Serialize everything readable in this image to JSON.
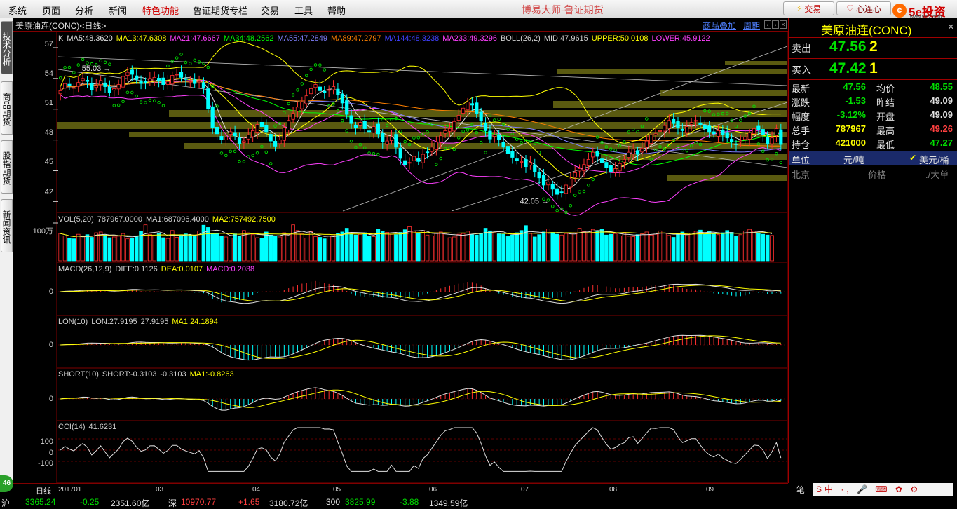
{
  "menu": [
    "系统",
    "页面",
    "分析",
    "新闻",
    "特色功能",
    "鲁证期货专栏",
    "交易",
    "工具",
    "帮助"
  ],
  "highlight_menu": "特色功能",
  "app_title": "博易大师-鲁证期货",
  "toolbar": {
    "trade_label": "交易",
    "xinlian_label": "心连心",
    "brand_text": "5e投资",
    "brand_url": "www.5etz.com"
  },
  "left_tabs": [
    "技术分析",
    "商品期货",
    "股指期货",
    "新闻资讯"
  ],
  "left_badge": "46",
  "chart_header": {
    "symbol": "美原油连(CONC)<日线>",
    "overlay_link": "商品叠加",
    "period_link": "周期"
  },
  "indicators": {
    "main": [
      {
        "text": "K",
        "color": "#d0d0d0"
      },
      {
        "text": "MA5:48.3620",
        "color": "#e0e0e0"
      },
      {
        "text": "MA13:47.6308",
        "color": "#ffff00"
      },
      {
        "text": "MA21:47.6667",
        "color": "#ff40ff"
      },
      {
        "text": "MA34:48.2562",
        "color": "#00ff00"
      },
      {
        "text": "MA55:47.2849",
        "color": "#8080ff"
      },
      {
        "text": "MA89:47.2797",
        "color": "#ff8000"
      },
      {
        "text": "MA144:48.3238",
        "color": "#4040ff"
      },
      {
        "text": "MA233:49.3296",
        "color": "#ff40ff"
      },
      {
        "text": "BOLL(26,2)",
        "color": "#d0d0d0"
      },
      {
        "text": "MID:47.9615",
        "color": "#d0d0d0"
      },
      {
        "text": "UPPER:50.0108",
        "color": "#ffff00"
      },
      {
        "text": "LOWER:45.9122",
        "color": "#ff40ff"
      }
    ],
    "vol": [
      {
        "text": "VOL(5,20)",
        "color": "#d0d0d0"
      },
      {
        "text": "787967.0000",
        "color": "#d0d0d0"
      },
      {
        "text": "MA1:687096.4000",
        "color": "#d0d0d0"
      },
      {
        "text": "MA2:757492.7500",
        "color": "#ffff00"
      }
    ],
    "macd": [
      {
        "text": "MACD(26,12,9)",
        "color": "#d0d0d0"
      },
      {
        "text": "DIFF:0.1126",
        "color": "#d0d0d0"
      },
      {
        "text": "DEA:0.0107",
        "color": "#ffff00"
      },
      {
        "text": "MACD:0.2038",
        "color": "#ff40ff"
      }
    ],
    "lon": [
      {
        "text": "LON(10)",
        "color": "#d0d0d0"
      },
      {
        "text": "LON:27.9195",
        "color": "#d0d0d0"
      },
      {
        "text": "27.9195",
        "color": "#d0d0d0"
      },
      {
        "text": "MA1:24.1894",
        "color": "#ffff00"
      }
    ],
    "short": [
      {
        "text": "SHORT(10)",
        "color": "#d0d0d0"
      },
      {
        "text": "SHORT:-0.3103",
        "color": "#d0d0d0"
      },
      {
        "text": "-0.3103",
        "color": "#d0d0d0"
      },
      {
        "text": "MA1:-0.8263",
        "color": "#ffff00"
      }
    ],
    "cci": [
      {
        "text": "CCI(14)",
        "color": "#d0d0d0"
      },
      {
        "text": "41.6231",
        "color": "#d0d0d0"
      }
    ]
  },
  "axes": {
    "price_ticks": [
      "57",
      "54",
      "51",
      "48",
      "45",
      "42"
    ],
    "vol_tick": "100万",
    "macd_tick": "0",
    "lon_tick": "0",
    "short_tick": "0",
    "cci_ticks": [
      "100",
      "0",
      "-100"
    ],
    "x_labels": [
      "201701",
      "03",
      "04",
      "05",
      "06",
      "07",
      "08",
      "09"
    ]
  },
  "chart_data": {
    "type": "candlestick",
    "price_ylim": [
      41,
      58.5
    ],
    "high_mark": "55.03",
    "low_mark": "42.05",
    "close_series": [
      52.8,
      53.5,
      53.3,
      53.1,
      53.6,
      54.0,
      53.7,
      52.9,
      53.3,
      53.8,
      53.2,
      52.6,
      53.0,
      53.4,
      54.2,
      54.6,
      54.4,
      53.9,
      53.5,
      53.6,
      54.0,
      54.1,
      53.8,
      53.4,
      53.7,
      54.3,
      54.4,
      54.1,
      53.9,
      53.7,
      53.5,
      53.8,
      53.1,
      51.0,
      49.2,
      48.6,
      48.0,
      48.3,
      48.8,
      48.4,
      47.6,
      47.9,
      48.5,
      48.9,
      49.5,
      49.3,
      48.8,
      47.9,
      47.4,
      48.0,
      49.2,
      49.9,
      50.6,
      51.2,
      51.7,
      52.3,
      53.0,
      53.4,
      52.8,
      52.6,
      52.9,
      53.2,
      52.4,
      51.6,
      50.5,
      49.6,
      49.2,
      49.7,
      49.1,
      48.8,
      49.3,
      48.6,
      47.8,
      47.9,
      48.3,
      47.3,
      46.2,
      45.6,
      45.8,
      46.4,
      45.9,
      46.6,
      46.8,
      47.3,
      47.8,
      48.4,
      48.9,
      49.1,
      49.8,
      50.4,
      51.1,
      51.7,
      51.4,
      50.6,
      49.9,
      48.9,
      48.1,
      48.5,
      48.0,
      47.3,
      46.7,
      46.3,
      46.0,
      45.9,
      45.4,
      45.8,
      44.9,
      44.3,
      43.6,
      43.9,
      43.2,
      42.7,
      42.9,
      43.6,
      44.2,
      44.8,
      45.2,
      45.6,
      46.1,
      46.8,
      46.4,
      45.8,
      45.3,
      44.9,
      45.2,
      45.7,
      46.1,
      46.8,
      47.1,
      46.6,
      47.2,
      47.9,
      48.5,
      48.6,
      48.9,
      49.4,
      49.9,
      49.6,
      49.2,
      48.9,
      49.3,
      49.7,
      49.9,
      49.5,
      49.1,
      48.8,
      48.6,
      48.9,
      48.5,
      48.2,
      47.8,
      47.6,
      47.9,
      48.3,
      48.7,
      49.1,
      49.0,
      48.5,
      47.6,
      48.2,
      49.09,
      47.56
    ],
    "volume_series": [
      72,
      66,
      60,
      58,
      70,
      64,
      69,
      62,
      74,
      76,
      68,
      61,
      63,
      65,
      72,
      58,
      60,
      66,
      78,
      95,
      70,
      66,
      73,
      61,
      59,
      80,
      62,
      68,
      71,
      67,
      64,
      79,
      94,
      88,
      73,
      72,
      66,
      63,
      60,
      71,
      66,
      80,
      74,
      69,
      61,
      60,
      76,
      68,
      65,
      63,
      74,
      70,
      95,
      80,
      71,
      60,
      77,
      64,
      62,
      58,
      66,
      69,
      73,
      76,
      86,
      71,
      68,
      70,
      74,
      65,
      64,
      84,
      77,
      75,
      70,
      69,
      75,
      82,
      90,
      78,
      72,
      80,
      68,
      66,
      74,
      76,
      71,
      61,
      63,
      70,
      72,
      78,
      69,
      68,
      73,
      86,
      79,
      76,
      71,
      70,
      64,
      68,
      74,
      80,
      93,
      72,
      63,
      69,
      76,
      84,
      75,
      70,
      68,
      72,
      71,
      74,
      86,
      77,
      74,
      83,
      79,
      84,
      68,
      70,
      72,
      66,
      75,
      65,
      64,
      69,
      71,
      76,
      68,
      70,
      79,
      73,
      67,
      62,
      71,
      76,
      69,
      73,
      78,
      81,
      70,
      77,
      73,
      69,
      74,
      80,
      75,
      66,
      69,
      79,
      83,
      78,
      74,
      70,
      68,
      67
    ]
  },
  "right_panel": {
    "title": "美原油连(CONC)",
    "sell_label": "卖出",
    "sell_price": "47.56",
    "sell_vol": "2",
    "buy_label": "买入",
    "buy_price": "47.42",
    "buy_vol": "1",
    "rows": [
      {
        "l1": "最新",
        "v1": "47.56",
        "c1": "#00e000",
        "l2": "均价",
        "v2": "48.55",
        "c2": "#00e000"
      },
      {
        "l1": "涨跌",
        "v1": "-1.53",
        "c1": "#00e000",
        "l2": "昨结",
        "v2": "49.09",
        "c2": "#e0e0e0"
      },
      {
        "l1": "幅度",
        "v1": "-3.12%",
        "c1": "#00e000",
        "l2": "开盘",
        "v2": "49.09",
        "c2": "#e0e0e0"
      },
      {
        "l1": "总手",
        "v1": "787967",
        "c1": "#ffff00",
        "l2": "最高",
        "v2": "49.26",
        "c2": "#ff4040"
      },
      {
        "l1": "持仓",
        "v1": "421000",
        "c1": "#ffff00",
        "l2": "最低",
        "v2": "47.27",
        "c2": "#00e000"
      }
    ],
    "unit_label": "单位",
    "unit_value": "元/吨",
    "unit_alt": "美元/桶",
    "tick_city": "北京",
    "tick_price": "价格",
    "tick_vol": "./大单",
    "bottom_label": "笔"
  },
  "bottom_tab": "日线",
  "status": [
    {
      "text": "沪",
      "color": "#e0e0e0"
    },
    {
      "text": "3365.24",
      "color": "#00e000"
    },
    {
      "text": "-0.25",
      "color": "#00e000"
    },
    {
      "text": "2351.60亿",
      "color": "#e0e0e0"
    },
    {
      "text": "深",
      "color": "#e0e0e0"
    },
    {
      "text": "10970.77",
      "color": "#ff4040"
    },
    {
      "text": "+1.65",
      "color": "#ff4040"
    },
    {
      "text": "3180.72亿",
      "color": "#e0e0e0"
    },
    {
      "text": "300",
      "color": "#e0e0e0"
    },
    {
      "text": "3825.99",
      "color": "#00e000"
    },
    {
      "text": "-3.88",
      "color": "#00e000"
    },
    {
      "text": "1349.59亿",
      "color": "#e0e0e0"
    }
  ],
  "colors": {
    "up": "#ff3030",
    "down": "#00ffff",
    "grid": "#800000",
    "panel_border": "#a00000"
  }
}
